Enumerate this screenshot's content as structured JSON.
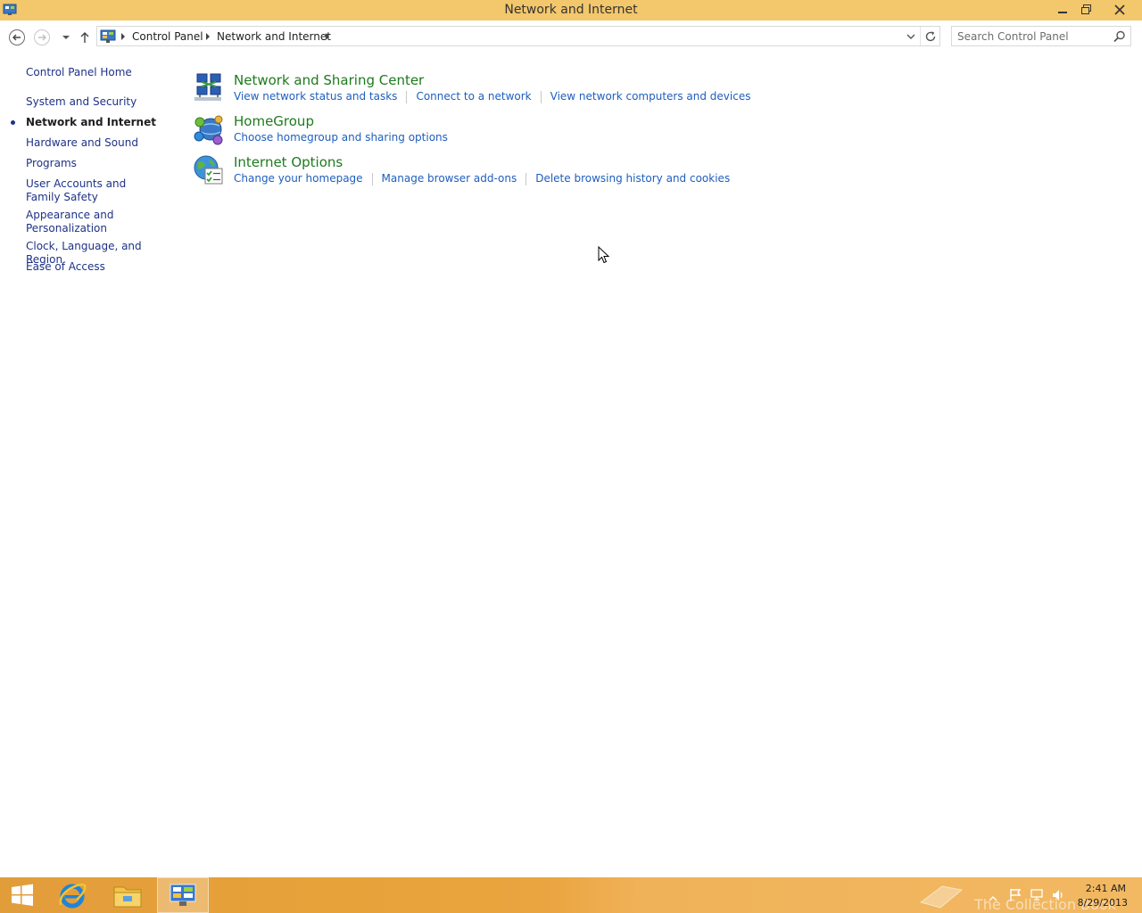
{
  "window": {
    "title": "Network and Internet"
  },
  "address": {
    "crumbs": [
      "Control Panel",
      "Network and Internet"
    ]
  },
  "search": {
    "placeholder": "Search Control Panel"
  },
  "leftnav": {
    "home": "Control Panel Home",
    "items": [
      {
        "label": "System and Security"
      },
      {
        "label": "Network and Internet",
        "active": true
      },
      {
        "label": "Hardware and Sound"
      },
      {
        "label": "Programs"
      },
      {
        "label": "User Accounts and Family Safety"
      },
      {
        "label": "Appearance and Personalization"
      },
      {
        "label": "Clock, Language, and Region"
      },
      {
        "label": "Ease of Access"
      }
    ]
  },
  "categories": [
    {
      "title": "Network and Sharing Center",
      "icon": "network-sharing-icon",
      "links": [
        "View network status and tasks",
        "Connect to a network",
        "View network computers and devices"
      ]
    },
    {
      "title": "HomeGroup",
      "icon": "homegroup-icon",
      "links": [
        "Choose homegroup and sharing options"
      ]
    },
    {
      "title": "Internet Options",
      "icon": "internet-options-icon",
      "links": [
        "Change your homepage",
        "Manage browser add-ons",
        "Delete browsing history and cookies"
      ]
    }
  ],
  "taskbar": {
    "watermark": "The Collection Book",
    "time": "2:41 AM",
    "date": "8/29/2013"
  },
  "colors": {
    "titlebar": "#f3c76b",
    "category_title": "#1e7a1e",
    "link": "#1e5ebd",
    "nav_link": "#1e3287"
  }
}
